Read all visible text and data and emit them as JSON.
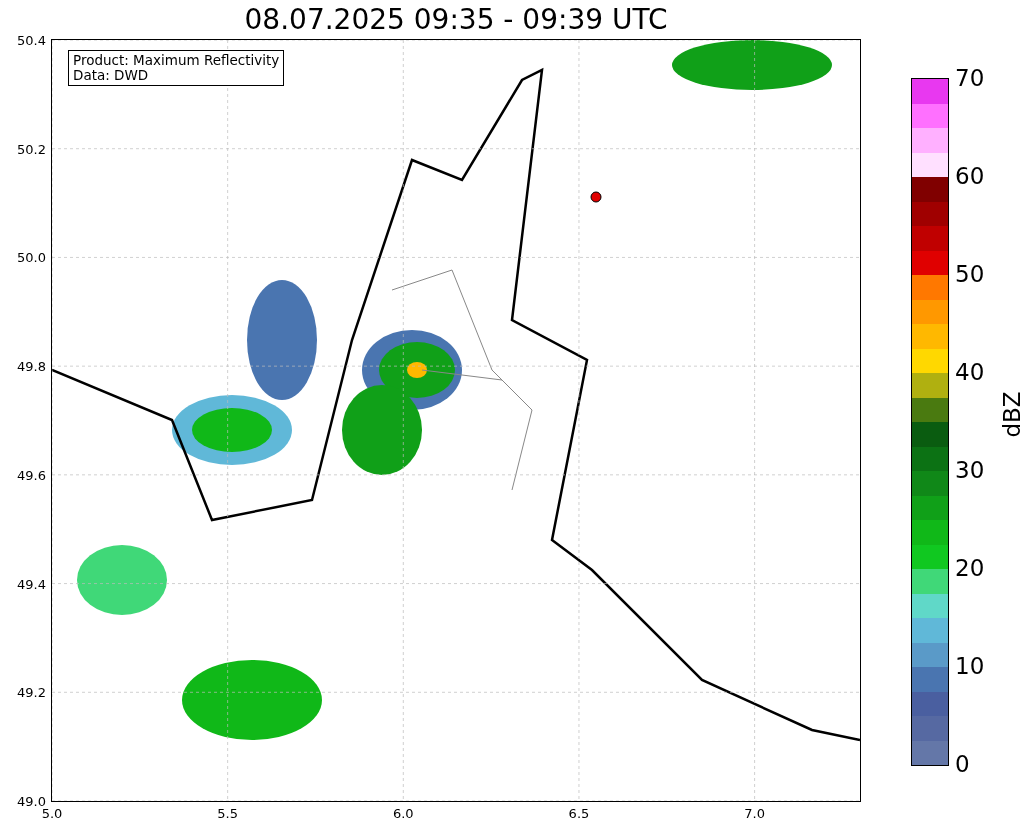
{
  "title": "08.07.2025 09:35 - 09:39 UTC",
  "info_box": {
    "lines": [
      "Product: Maximum Reflectivity",
      "Data: DWD"
    ]
  },
  "map": {
    "y_ticks": [
      "50.4",
      "50.2",
      "50.0",
      "49.8",
      "49.6",
      "49.4",
      "49.2",
      "49.0"
    ],
    "x_ticks": [
      "5.0",
      "5.5",
      "6.0",
      "6.5",
      "7.0"
    ]
  },
  "colorbar": {
    "label": "dBZ",
    "ticks": [
      "70",
      "60",
      "50",
      "40",
      "30",
      "20",
      "10",
      "0"
    ],
    "bins": [
      {
        "color": "#6477a8"
      },
      {
        "color": "#5669a2"
      },
      {
        "color": "#4a5fa0"
      },
      {
        "color": "#4a75b0"
      },
      {
        "color": "#5a9ac8"
      },
      {
        "color": "#60b8d8"
      },
      {
        "color": "#60d8c8"
      },
      {
        "color": "#40d878"
      },
      {
        "color": "#10c820"
      },
      {
        "color": "#10b818"
      },
      {
        "color": "#10a018"
      },
      {
        "color": "#108818"
      },
      {
        "color": "#0c7214"
      },
      {
        "color": "#0a5c10"
      },
      {
        "color": "#4a7a10"
      },
      {
        "color": "#b0b010"
      },
      {
        "color": "#ffd800"
      },
      {
        "color": "#ffb800"
      },
      {
        "color": "#ff9800"
      },
      {
        "color": "#ff7800"
      },
      {
        "color": "#e00000"
      },
      {
        "color": "#c00000"
      },
      {
        "color": "#a00000"
      },
      {
        "color": "#800000"
      },
      {
        "color": "#ffe0ff"
      },
      {
        "color": "#ffb0ff"
      },
      {
        "color": "#ff70ff"
      },
      {
        "color": "#e838f0"
      }
    ]
  }
}
